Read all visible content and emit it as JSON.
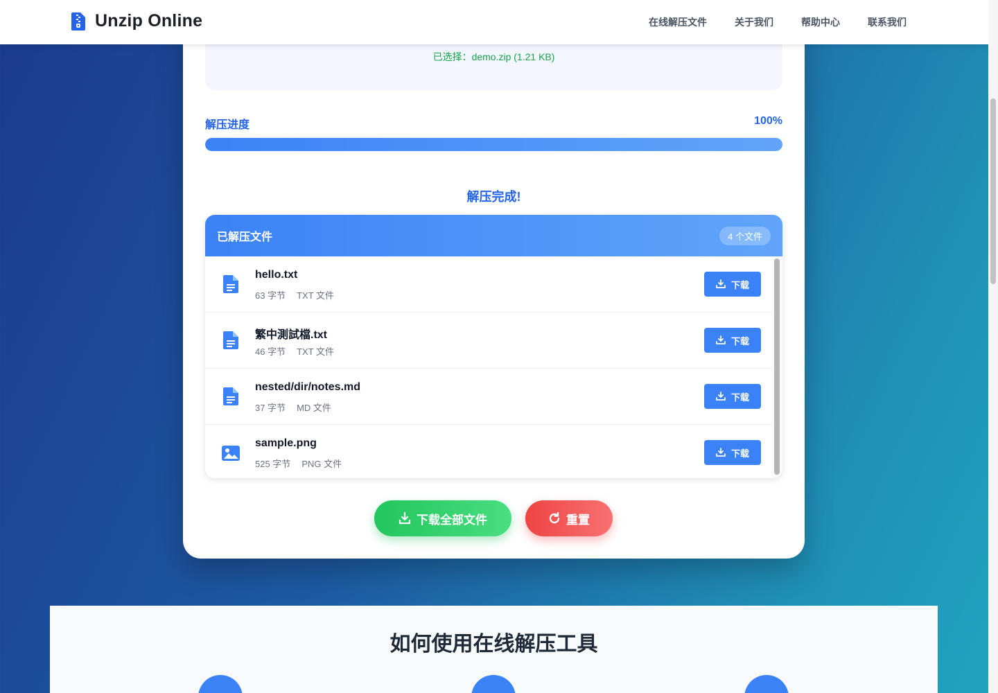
{
  "header": {
    "brand": "Unzip Online",
    "nav": [
      "在线解压文件",
      "关于我们",
      "帮助中心",
      "联系我们"
    ]
  },
  "upload": {
    "selected": "已选择：demo.zip (1.21 KB)"
  },
  "progress": {
    "label": "解压进度",
    "percent_text": "100%",
    "value": 1.0
  },
  "status": {
    "done": "解压完成!"
  },
  "files_panel": {
    "title": "已解压文件",
    "count": "4 个文件",
    "download_label": "下载",
    "files": [
      {
        "name": "hello.txt",
        "size": "63 字节",
        "type": "TXT 文件",
        "icon": "document-icon"
      },
      {
        "name": "繁中測試檔.txt",
        "size": "46 字节",
        "type": "TXT 文件",
        "icon": "document-icon"
      },
      {
        "name": "nested/dir/notes.md",
        "size": "37 字节",
        "type": "MD 文件",
        "icon": "document-icon"
      },
      {
        "name": "sample.png",
        "size": "525 字节",
        "type": "PNG 文件",
        "icon": "image-icon"
      }
    ]
  },
  "actions": {
    "download_all": "下载全部文件",
    "reset": "重置"
  },
  "howto": {
    "title": "如何使用在线解压工具"
  },
  "colors": {
    "primary": "#3b82f6",
    "success": "#22c55e",
    "danger": "#ef4444",
    "success_text": "#16a34a"
  }
}
